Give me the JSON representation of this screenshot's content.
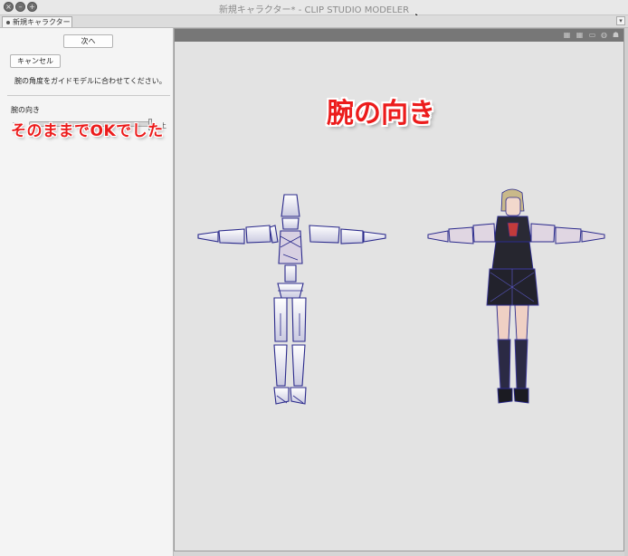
{
  "window": {
    "title": "新規キャラクター* - CLIP STUDIO MODELER"
  },
  "tabs": [
    {
      "label": "新規キャラクター*"
    }
  ],
  "panel": {
    "next_label": "次へ",
    "cancel_label": "キャンセル",
    "instruction": "腕の角度をガイドモデルに合わせてください。",
    "section_label": "腕の向き",
    "slider": {
      "min_label": "下",
      "max_label": "上",
      "value": 1.0
    }
  },
  "annotations": {
    "left_note": "そのままでOKでした",
    "heading": "腕の向き"
  },
  "viewport": {
    "toolbar_icons": [
      "grid-icon",
      "grid-alt-icon",
      "view-icon",
      "camera-icon",
      "figure-icon"
    ]
  },
  "colors": {
    "annotation_red": "#ec1c1c",
    "wireframe_blue": "#2b2a8c",
    "viewport_bg": "#e3e3e3"
  }
}
